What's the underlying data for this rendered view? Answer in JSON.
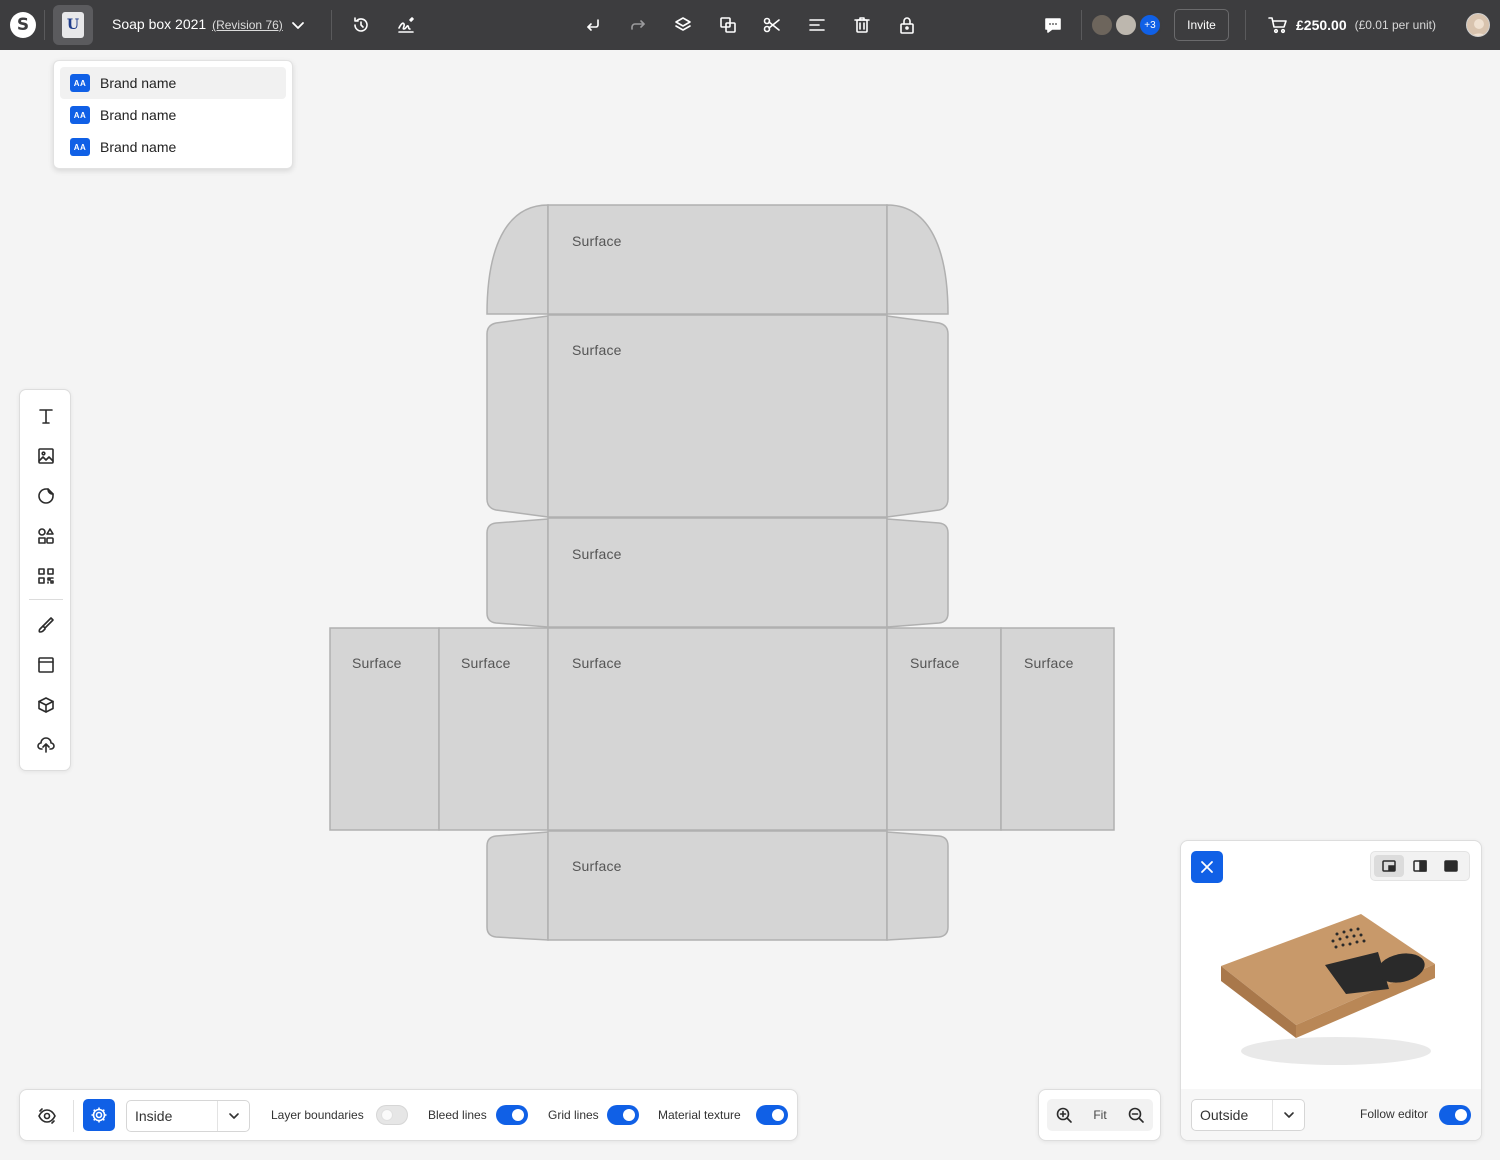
{
  "topbar": {
    "app_logo": "S",
    "brand_logo": "U",
    "project_title": "Soap box 2021",
    "revision": "(Revision 76)",
    "collaborators_more": "+3",
    "invite_label": "Invite",
    "price": "£250.00",
    "price_unit": "(£0.01 per unit)",
    "icons": [
      "history-icon",
      "signature-icon",
      "undo-icon",
      "redo-icon",
      "layers-icon",
      "duplicate-icon",
      "cut-icon",
      "align-icon",
      "delete-icon",
      "lock-icon",
      "comments-icon",
      "cart-icon"
    ]
  },
  "brand_menu": {
    "badge": "AA",
    "items": [
      {
        "label": "Brand name"
      },
      {
        "label": "Brand name"
      },
      {
        "label": "Brand name"
      }
    ]
  },
  "left_tools": [
    "text-icon",
    "image-icon",
    "sticker-icon",
    "shapes-icon",
    "qr-code-icon",
    "brush-icon",
    "template-icon",
    "box-icon",
    "upload-icon"
  ],
  "dieline": {
    "surfaces": [
      "Surface",
      "Surface",
      "Surface",
      "Surface",
      "Surface",
      "Surface",
      "Surface",
      "Surface",
      "Surface"
    ]
  },
  "bottom_bar": {
    "view_select": "Inside",
    "toggles": [
      {
        "label": "Layer boundaries",
        "on": false
      },
      {
        "label": "Bleed lines",
        "on": true
      },
      {
        "label": "Grid lines",
        "on": true
      },
      {
        "label": "Material texture",
        "on": true
      }
    ]
  },
  "zoom": {
    "fit_label": "Fit"
  },
  "preview": {
    "side_select": "Outside",
    "follow_label": "Follow editor",
    "follow_on": true
  },
  "colors": {
    "accent": "#1060e6",
    "topbar": "#3d3d3f",
    "panel": "#d5d5d5",
    "kraft": "#c8996a"
  }
}
